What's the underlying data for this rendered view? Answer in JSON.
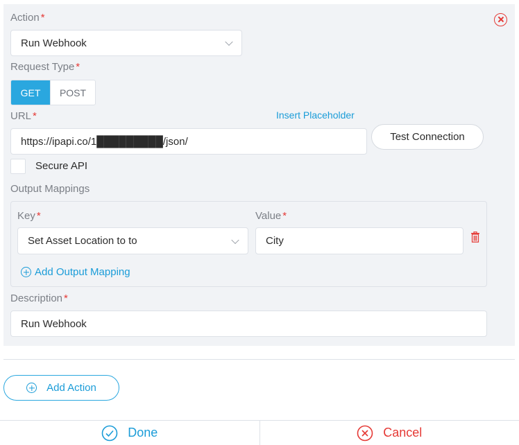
{
  "action": {
    "label": "Action",
    "value": "Run Webhook"
  },
  "request_type": {
    "label": "Request Type",
    "options": [
      "GET",
      "POST"
    ],
    "selected": "GET"
  },
  "url": {
    "label": "URL",
    "value": "https://ipapi.co/1█████████/json/",
    "insert_placeholder": "Insert Placeholder",
    "test_connection": "Test Connection"
  },
  "secure_api": {
    "label": "Secure API",
    "checked": false
  },
  "output_mappings": {
    "label": "Output Mappings",
    "key_label": "Key",
    "value_label": "Value",
    "rows": [
      {
        "key": "Set Asset Location to to",
        "value": "City"
      }
    ],
    "add_label": "Add Output Mapping"
  },
  "description": {
    "label": "Description",
    "value": "Run Webhook"
  },
  "add_action": "Add Action",
  "footer": {
    "done": "Done",
    "cancel": "Cancel"
  },
  "colors": {
    "accent": "#2aa7df",
    "danger": "#e53935",
    "panel_bg": "#f1f3f6"
  },
  "icons": {
    "remove_action": "close-circle-icon",
    "delete_mapping": "trash-icon",
    "add": "plus-circle-icon",
    "done": "check-circle-icon",
    "cancel": "close-circle-icon"
  }
}
